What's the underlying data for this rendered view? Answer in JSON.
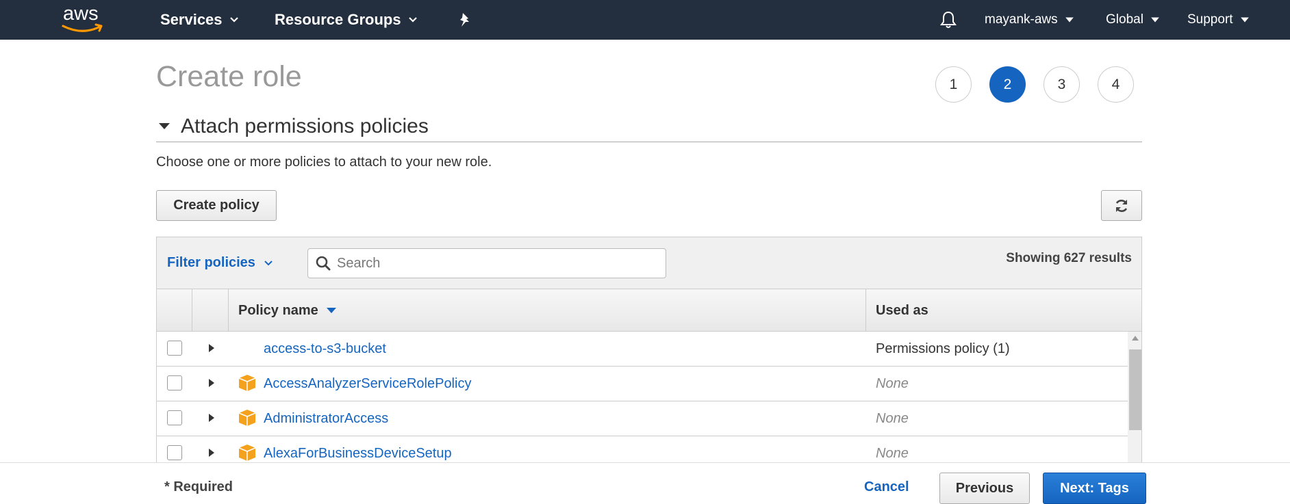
{
  "nav": {
    "logo": "aws",
    "services": "Services",
    "resource_groups": "Resource Groups",
    "pin_icon": "pin-icon",
    "bell_icon": "bell-icon",
    "account": "mayank-aws",
    "region": "Global",
    "support": "Support"
  },
  "page": {
    "title": "Create role",
    "steps": [
      "1",
      "2",
      "3",
      "4"
    ],
    "active_step": "2",
    "section_title": "Attach permissions policies",
    "description": "Choose one or more policies to attach to your new role.",
    "create_policy": "Create policy",
    "refresh_icon": "refresh-icon"
  },
  "table": {
    "filter_label": "Filter policies",
    "search_placeholder": "Search",
    "results_text": "Showing 627 results",
    "columns": {
      "name": "Policy name",
      "used_as": "Used as"
    },
    "rows": [
      {
        "name": "access-to-s3-bucket",
        "used_as": "Permissions policy (1)",
        "aws_managed": false
      },
      {
        "name": "AccessAnalyzerServiceRolePolicy",
        "used_as": "None",
        "aws_managed": true
      },
      {
        "name": "AdministratorAccess",
        "used_as": "None",
        "aws_managed": true
      },
      {
        "name": "AlexaForBusinessDeviceSetup",
        "used_as": "None",
        "aws_managed": true
      }
    ]
  },
  "footer": {
    "required": "* Required",
    "cancel": "Cancel",
    "previous": "Previous",
    "next": "Next: Tags"
  },
  "colors": {
    "nav_bg": "#232f3e",
    "accent_blue": "#1565c0",
    "aws_orange": "#ff9900",
    "package_orange": "#f4a11e"
  }
}
